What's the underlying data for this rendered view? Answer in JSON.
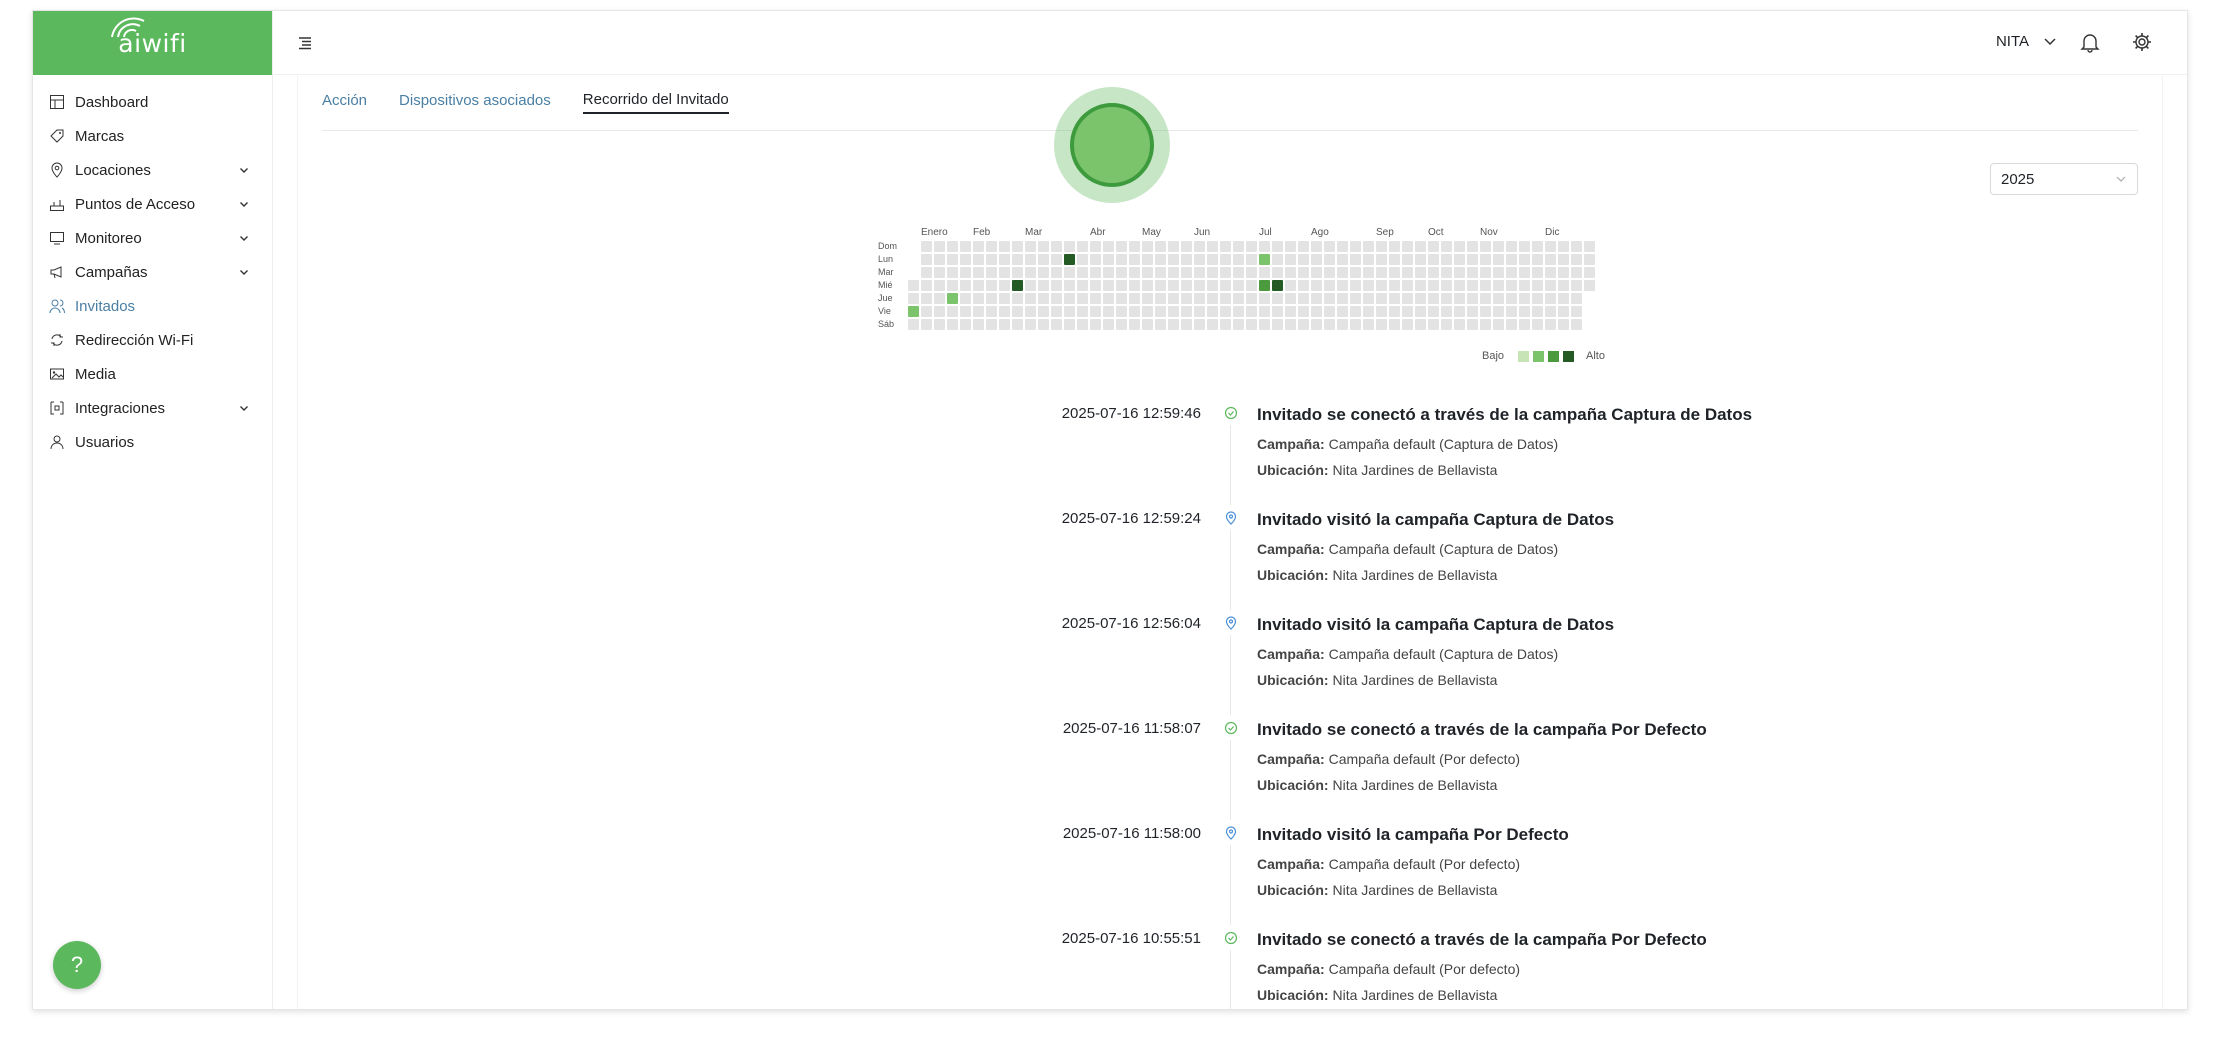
{
  "brand": {
    "name": "aiwifi",
    "color": "#5cb85c"
  },
  "sidebar": {
    "items": [
      {
        "label": "Dashboard",
        "icon": "dashboard-icon",
        "expandable": false
      },
      {
        "label": "Marcas",
        "icon": "tag-icon",
        "expandable": false
      },
      {
        "label": "Locaciones",
        "icon": "location-pin-icon",
        "expandable": true
      },
      {
        "label": "Puntos de Acceso",
        "icon": "router-icon",
        "expandable": true
      },
      {
        "label": "Monitoreo",
        "icon": "monitor-icon",
        "expandable": true
      },
      {
        "label": "Campañas",
        "icon": "megaphone-icon",
        "expandable": true
      },
      {
        "label": "Invitados",
        "icon": "users-icon",
        "expandable": false,
        "active": true
      },
      {
        "label": "Redirección Wi-Fi",
        "icon": "redirect-icon",
        "expandable": false
      },
      {
        "label": "Media",
        "icon": "media-icon",
        "expandable": false
      },
      {
        "label": "Integraciones",
        "icon": "integration-icon",
        "expandable": true
      },
      {
        "label": "Usuarios",
        "icon": "user-icon",
        "expandable": false
      }
    ],
    "help_label": "?"
  },
  "topbar": {
    "user": "NITA"
  },
  "tabs": [
    {
      "label": "Acción",
      "active": false
    },
    {
      "label": "Dispositivos asociados",
      "active": false
    },
    {
      "label": "Recorrido del Invitado",
      "active": true
    }
  ],
  "year_select": {
    "value": "2025"
  },
  "heatmap": {
    "months": [
      "Enero",
      "Feb",
      "Mar",
      "Abr",
      "May",
      "Jun",
      "Jul",
      "Ago",
      "Sep",
      "Oct",
      "Nov",
      "Dic"
    ],
    "days": [
      "Dom",
      "Lun",
      "Mar",
      "Mié",
      "Jue",
      "Vie",
      "Sáb"
    ],
    "weeks": 53,
    "active_cells": [
      {
        "week": 0,
        "day": 5,
        "level": 2
      },
      {
        "week": 3,
        "day": 4,
        "level": 2
      },
      {
        "week": 8,
        "day": 3,
        "level": 4
      },
      {
        "week": 12,
        "day": 1,
        "level": 4
      },
      {
        "week": 27,
        "day": 1,
        "level": 2
      },
      {
        "week": 27,
        "day": 3,
        "level": 3
      },
      {
        "week": 28,
        "day": 3,
        "level": 4
      }
    ],
    "colors": {
      "empty": "#e3e3e3",
      "l1": "#c6e4b5",
      "l2": "#7cc46b",
      "l3": "#4c9a3e",
      "l4": "#245a23"
    },
    "legend_low": "Bajo",
    "legend_high": "Alto"
  },
  "timeline": {
    "campaign_label": "Campaña:",
    "location_label": "Ubicación:",
    "entries": [
      {
        "time": "2025-07-16 12:59:46",
        "type": "connected",
        "title": "Invitado se conectó a través de la campaña Captura de Datos",
        "campaign": "Campaña default (Captura de Datos)",
        "location": "Nita Jardines de Bellavista"
      },
      {
        "time": "2025-07-16 12:59:24",
        "type": "visited",
        "title": "Invitado visitó la campaña Captura de Datos",
        "campaign": "Campaña default (Captura de Datos)",
        "location": "Nita Jardines de Bellavista"
      },
      {
        "time": "2025-07-16 12:56:04",
        "type": "visited",
        "title": "Invitado visitó la campaña Captura de Datos",
        "campaign": "Campaña default (Captura de Datos)",
        "location": "Nita Jardines de Bellavista"
      },
      {
        "time": "2025-07-16 11:58:07",
        "type": "connected",
        "title": "Invitado se conectó a través de la campaña Por Defecto",
        "campaign": "Campaña default (Por defecto)",
        "location": "Nita Jardines de Bellavista"
      },
      {
        "time": "2025-07-16 11:58:00",
        "type": "visited",
        "title": "Invitado visitó la campaña Por Defecto",
        "campaign": "Campaña default (Por defecto)",
        "location": "Nita Jardines de Bellavista"
      },
      {
        "time": "2025-07-16 10:55:51",
        "type": "connected",
        "title": "Invitado se conectó a través de la campaña Por Defecto",
        "campaign": "Campaña default (Por defecto)",
        "location": "Nita Jardines de Bellavista"
      }
    ],
    "colors": {
      "connected": "#5cb85c",
      "visited": "#4a90d9"
    }
  }
}
